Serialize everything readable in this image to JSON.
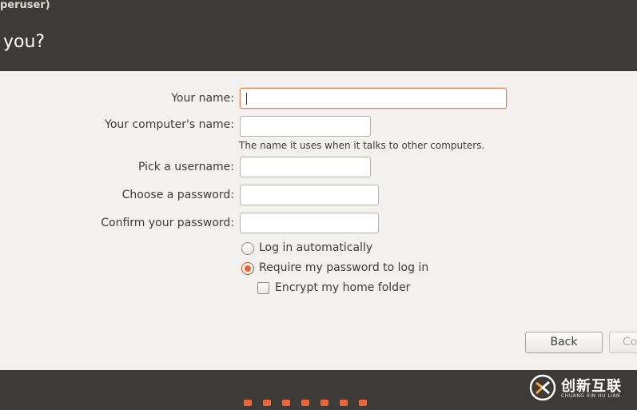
{
  "window": {
    "title": "peruser)"
  },
  "header": {
    "heading": "you?"
  },
  "form": {
    "name_label": "Your name:",
    "name_value": "",
    "computer_label": "Your computer's name:",
    "computer_value": "",
    "computer_hint": "The name it uses when it talks to other computers.",
    "username_label": "Pick a username:",
    "username_value": "",
    "password_label": "Choose a password:",
    "password_value": "",
    "confirm_label": "Confirm your password:",
    "confirm_value": ""
  },
  "login_options": {
    "auto_login_label": "Log in automatically",
    "auto_login_selected": false,
    "require_password_label": "Require my password to log in",
    "require_password_selected": true,
    "encrypt_label": "Encrypt my home folder",
    "encrypt_checked": false
  },
  "buttons": {
    "back_label": "Back",
    "continue_label": "Co"
  },
  "progress": {
    "total_steps": 7
  },
  "watermark": {
    "brand": "创新互联",
    "sub": "CHUANG XIN HU LIAN"
  },
  "colors": {
    "accent": "#e9673a",
    "header_bg": "#3c3b37",
    "content_bg": "#f2f1f0"
  }
}
